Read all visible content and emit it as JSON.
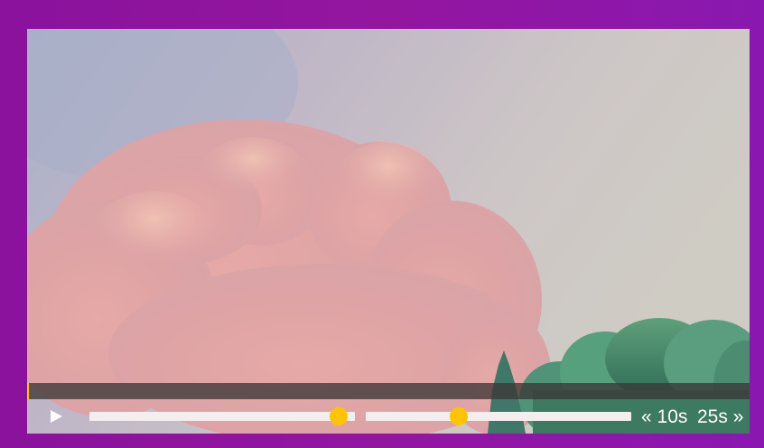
{
  "player": {
    "progress": 0.0025,
    "volume": 0.94,
    "playback_rate": 0.35,
    "skip_back_label": "« 10s",
    "skip_forward_label": "25s »",
    "play_icon": "play-icon"
  },
  "colors": {
    "page_background": "#8e149e",
    "accent": "#ffc800",
    "control_text": "#ffffff",
    "slider_rail": "#f4efee"
  }
}
